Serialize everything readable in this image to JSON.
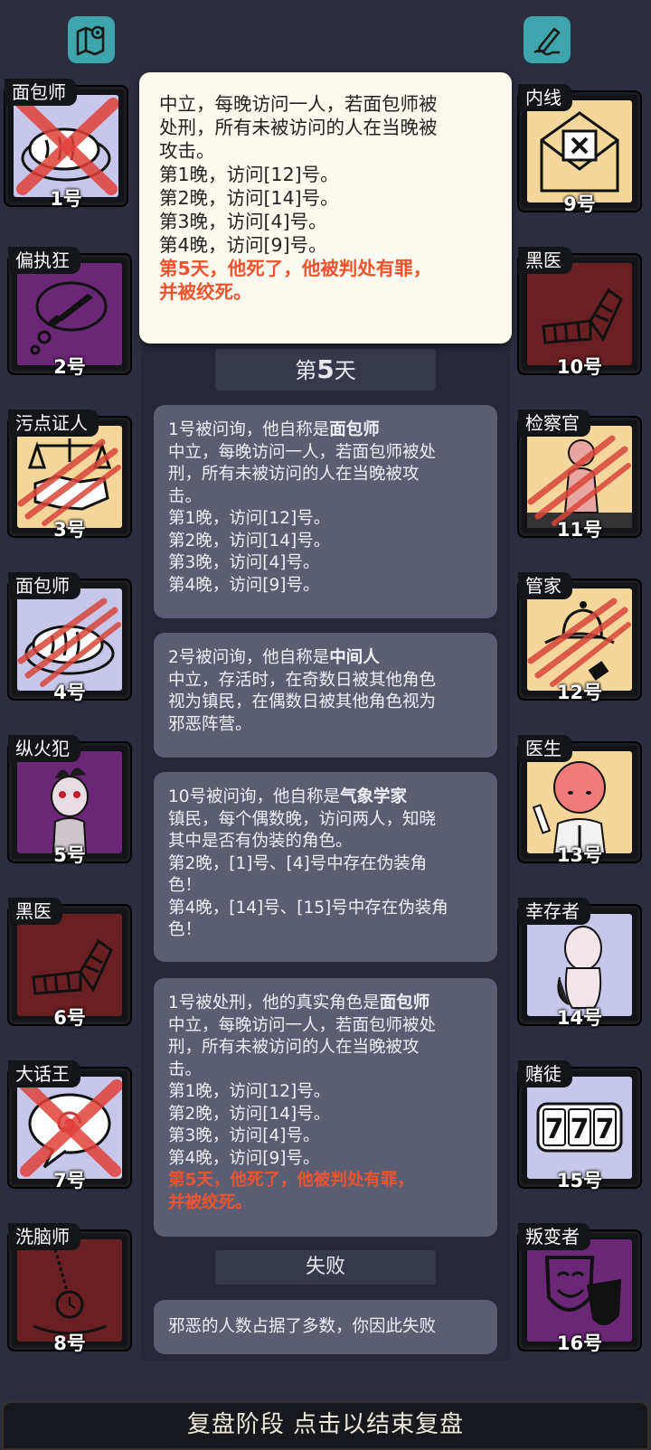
{
  "header": {
    "map_icon": "map-pin-icon",
    "notes_icon": "pen-note-icon"
  },
  "left_cards": [
    {
      "name": "面包师",
      "num": "1号",
      "bg": "#c6c7ea"
    },
    {
      "name": "偏执狂",
      "num": "2号",
      "bg": "#6a2775"
    },
    {
      "name": "污点证人",
      "num": "3号",
      "bg": "#f5d79b"
    },
    {
      "name": "面包师",
      "num": "4号",
      "bg": "#c6c7ea"
    },
    {
      "name": "纵火犯",
      "num": "5号",
      "bg": "#6a2775"
    },
    {
      "name": "黑医",
      "num": "6号",
      "bg": "#6a1f22"
    },
    {
      "name": "大话王",
      "num": "7号",
      "bg": "#c6c7ea"
    },
    {
      "name": "洗脑师",
      "num": "8号",
      "bg": "#6a1f22"
    }
  ],
  "right_cards": [
    {
      "name": "内线",
      "num": "9号",
      "bg": "#f5d79b"
    },
    {
      "name": "黑医",
      "num": "10号",
      "bg": "#6a1f22"
    },
    {
      "name": "检察官",
      "num": "11号",
      "bg": "#f5d79b"
    },
    {
      "name": "管家",
      "num": "12号",
      "bg": "#f5d79b"
    },
    {
      "name": "医生",
      "num": "13号",
      "bg": "#f5d79b"
    },
    {
      "name": "幸存者",
      "num": "14号",
      "bg": "#c6c7ea"
    },
    {
      "name": "赌徒",
      "num": "15号",
      "bg": "#c6c7ea"
    },
    {
      "name": "叛变者",
      "num": "16号",
      "bg": "#6a2775"
    }
  ],
  "tooltip": {
    "line1": "中立，每晚访问一人，若面包师被",
    "line2": "处刑，所有未被访问的人在当晚被",
    "line3": "攻击。",
    "line4": "第1晚，访问[12]号。",
    "line5": "第2晚，访问[14]号。",
    "line6": "第3晚，访问[4]号。",
    "line7": "第4晚，访问[9]号。",
    "red1": "第5天，他死了，他被判处有罪，",
    "red2": "并被绞死。"
  },
  "day": {
    "prefix": "第",
    "number": "5",
    "suffix": "天"
  },
  "logs": {
    "log1": {
      "intro": "1号被问询，他自称是",
      "role": "面包师",
      "l1": "中立，每晚访问一人，若面包师被处",
      "l2": "刑，所有未被访问的人在当晚被攻",
      "l3": "击。",
      "l4": "第1晚，访问[12]号。",
      "l5": "第2晚，访问[14]号。",
      "l6": "第3晚，访问[4]号。",
      "l7": "第4晚，访问[9]号。"
    },
    "log2": {
      "intro": "2号被问询，他自称是",
      "role": "中间人",
      "l1": "中立，存活时，在奇数日被其他角色",
      "l2": "视为镇民，在偶数日被其他角色视为",
      "l3": "邪恶阵营。"
    },
    "log3": {
      "intro": "10号被问询，他自称是",
      "role": "气象学家",
      "l1": "镇民，每个偶数晚，访问两人，知晓",
      "l2": "其中是否有伪装的角色。",
      "l3": "第2晚，[1]号、[4]号中存在伪装角",
      "l4": "色！",
      "l5": "第4晚，[14]号、[15]号中存在伪装角",
      "l6": "色！"
    },
    "log4": {
      "intro": "1号被处刑，他的真实角色是",
      "role": "面包师",
      "l1": "中立，每晚访问一人，若面包师被处",
      "l2": "刑，所有未被访问的人在当晚被攻",
      "l3": "击。",
      "l4": "第1晚，访问[12]号。",
      "l5": "第2晚，访问[14]号。",
      "l6": "第3晚，访问[4]号。",
      "l7": "第4晚，访问[9]号。",
      "red1": "第5天，他死了，他被判处有罪，",
      "red2": "并被绞死。"
    }
  },
  "result": {
    "header": "失败",
    "text": "邪恶的人数占据了多数，你因此失败"
  },
  "bottom_bar": {
    "label": "复盘阶段 点击以结束复盘"
  }
}
